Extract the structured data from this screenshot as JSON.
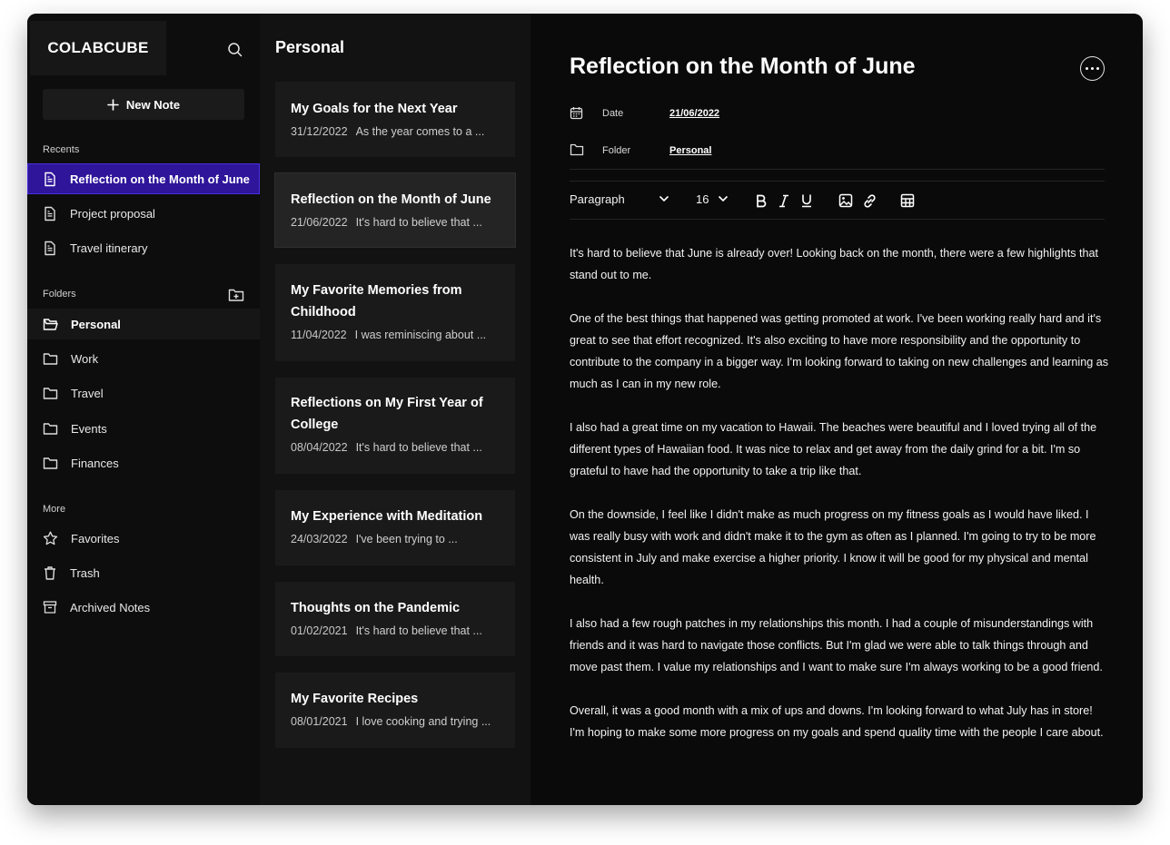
{
  "sidebar": {
    "logo": "COLABCUBE",
    "new_note_label": "New Note",
    "recents_label": "Recents",
    "recents": [
      {
        "label": "Reflection on the Month of June"
      },
      {
        "label": "Project proposal"
      },
      {
        "label": "Travel itinerary"
      }
    ],
    "folders_label": "Folders",
    "folders": [
      {
        "label": "Personal"
      },
      {
        "label": "Work"
      },
      {
        "label": "Travel"
      },
      {
        "label": "Events"
      },
      {
        "label": "Finances"
      }
    ],
    "more_label": "More",
    "more": [
      {
        "label": "Favorites",
        "icon": "star-icon"
      },
      {
        "label": "Trash",
        "icon": "trash-icon"
      },
      {
        "label": "Archived Notes",
        "icon": "archive-icon"
      }
    ]
  },
  "notes_list": {
    "title": "Personal",
    "notes": [
      {
        "title": "My Goals for the Next Year",
        "date": "31/12/2022",
        "preview": "As the year comes to a ..."
      },
      {
        "title": "Reflection on the Month of June",
        "date": "21/06/2022",
        "preview": "It's hard to believe that ..."
      },
      {
        "title": "My Favorite Memories from Childhood",
        "date": "11/04/2022",
        "preview": "I was reminiscing about ..."
      },
      {
        "title": "Reflections on My First Year of College",
        "date": "08/04/2022",
        "preview": "It's hard to believe that ..."
      },
      {
        "title": "My Experience with Meditation",
        "date": "24/03/2022",
        "preview": "I've been trying to ..."
      },
      {
        "title": "Thoughts on the Pandemic",
        "date": "01/02/2021",
        "preview": "It's hard to believe that ..."
      },
      {
        "title": "My Favorite Recipes",
        "date": "08/01/2021",
        "preview": "I love cooking and trying ..."
      }
    ]
  },
  "editor": {
    "title": "Reflection on the Month of June",
    "date_label": "Date",
    "date_value": "21/06/2022",
    "folder_label": "Folder",
    "folder_value": "Personal",
    "block_type": "Paragraph",
    "font_size": "16",
    "paragraphs": [
      "It's hard to believe that June is already over! Looking back on the month, there were a few highlights that stand out to me.",
      "One of the best things that happened was getting promoted at work. I've been working really hard and it's great to see that effort recognized. It's also exciting to have more responsibility and the opportunity to contribute to the company in a bigger way. I'm looking forward to taking on new challenges and learning as much as I can in my new role.",
      "I also had a great time on my vacation to Hawaii. The beaches were beautiful and I loved trying all of the different types of Hawaiian food. It was nice to relax and get away from the daily grind for a bit. I'm so grateful to have had the opportunity to take a trip like that.",
      "On the downside, I feel like I didn't make as much progress on my fitness goals as I would have liked. I was really busy with work and didn't make it to the gym as often as I planned. I'm going to try to be more consistent in July and make exercise a higher priority. I know it will be good for my physical and mental health.",
      "I also had a few rough patches in my relationships this month. I had a couple of misunderstandings with friends and it was hard to navigate those conflicts. But I'm glad we were able to talk things through and move past them. I value my relationships and I want to make sure I'm always working to be a good friend.",
      "Overall, it was a good month with a mix of ups and downs. I'm looking forward to what July has in store! I'm hoping to make some more progress on my goals and spend quality time with the people I care about."
    ]
  },
  "colors": {
    "active_item": "#2e159a",
    "background": "#0a0a0a"
  }
}
